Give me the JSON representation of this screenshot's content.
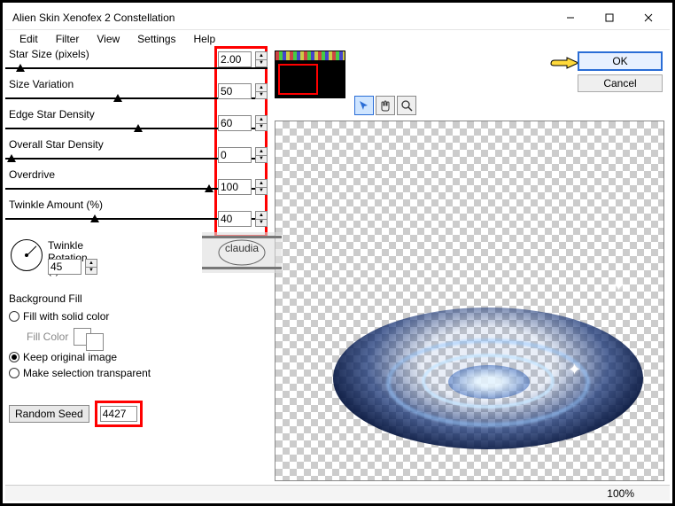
{
  "window": {
    "title": "Alien Skin Xenofex 2 Constellation"
  },
  "menu": [
    "Edit",
    "Filter",
    "View",
    "Settings",
    "Help"
  ],
  "sliders": [
    {
      "label": "Star Size (pixels)",
      "value": "2.00",
      "thumb": 12
    },
    {
      "label": "Size Variation",
      "value": "50",
      "thumb": 122
    },
    {
      "label": "Edge Star Density",
      "value": "60",
      "thumb": 145
    },
    {
      "label": "Overall Star Density",
      "value": "0",
      "thumb": 2
    },
    {
      "label": "Overdrive",
      "value": "100",
      "thumb": 225
    },
    {
      "label": "Twinkle Amount (%)",
      "value": "40",
      "thumb": 96
    }
  ],
  "twinkle": {
    "label": "Twinkle Rotation (°)",
    "value": "45"
  },
  "bgfill": {
    "header": "Background Fill",
    "opt_solid": "Fill with solid color",
    "fill_color": "Fill Color",
    "opt_keep": "Keep original image",
    "opt_trans": "Make selection transparent"
  },
  "seed": {
    "button": "Random Seed",
    "value": "4427"
  },
  "buttons": {
    "ok": "OK",
    "cancel": "Cancel"
  },
  "status": {
    "zoom": "100%"
  },
  "watermark": "claudia"
}
